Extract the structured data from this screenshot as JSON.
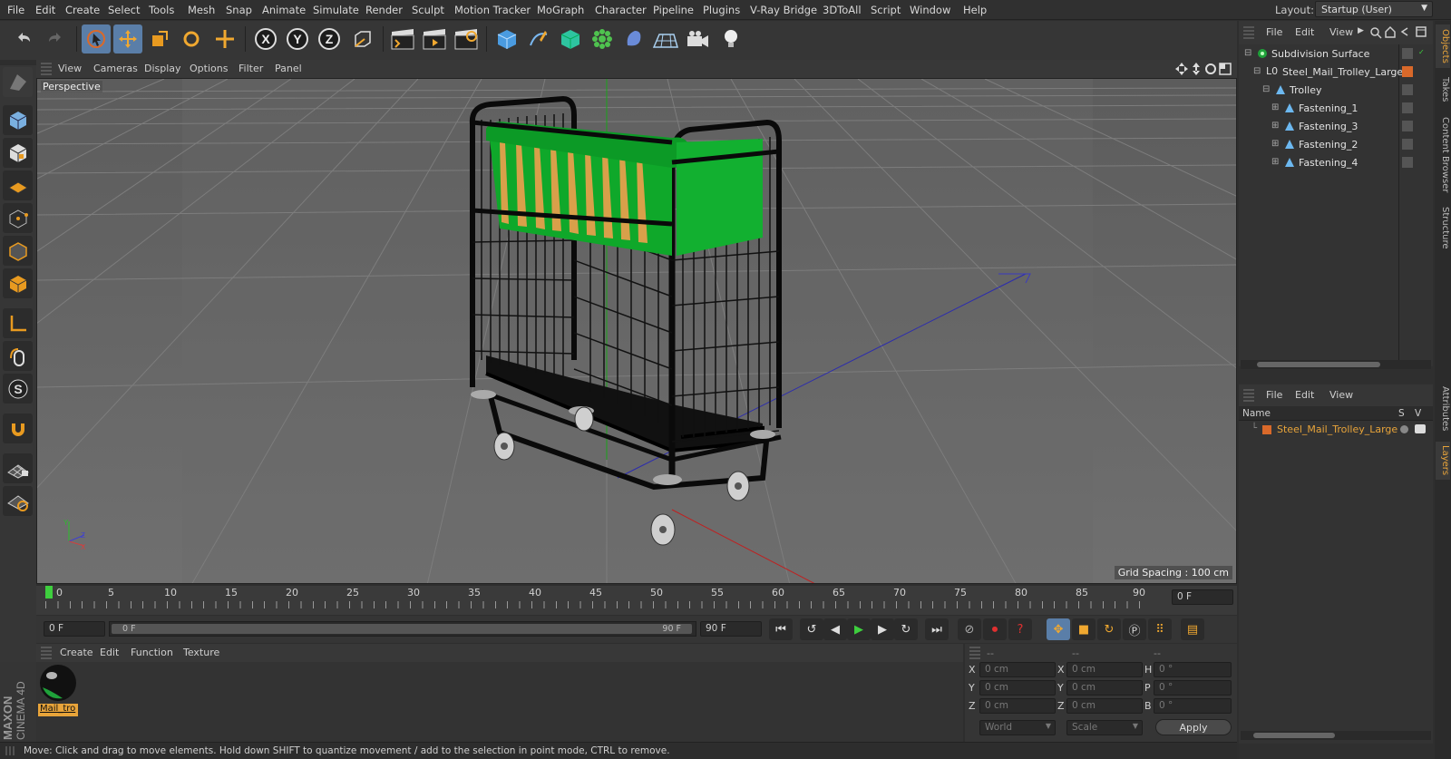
{
  "menubar": {
    "items": [
      "File",
      "Edit",
      "Create",
      "Select",
      "Tools",
      "Mesh",
      "Snap",
      "Animate",
      "Simulate",
      "Render",
      "Sculpt",
      "Motion Tracker",
      "MoGraph",
      "Character",
      "Pipeline",
      "Plugins",
      "V-Ray Bridge",
      "3DToAll",
      "Script",
      "Window",
      "Help"
    ],
    "layout_label": "Layout:",
    "layout_value": "Startup (User)"
  },
  "viewport": {
    "menus": [
      "View",
      "Cameras",
      "Display",
      "Options",
      "Filter",
      "Panel"
    ],
    "camera_label": "Perspective",
    "grid_spacing": "Grid Spacing : 100 cm"
  },
  "timeline": {
    "ticks": [
      "0",
      "5",
      "10",
      "15",
      "20",
      "25",
      "30",
      "35",
      "40",
      "45",
      "50",
      "55",
      "60",
      "65",
      "70",
      "75",
      "80",
      "85",
      "90"
    ],
    "current_frame": "0 F",
    "start_frame": "0 F",
    "range_start": "0 F",
    "range_end": "90 F",
    "end_frame": "90 F"
  },
  "material_manager": {
    "menus": [
      "Create",
      "Edit",
      "Function",
      "Texture"
    ],
    "material_name": "Mail_tro"
  },
  "coordinates": {
    "headers": [
      "--",
      "--",
      "--"
    ],
    "rows": [
      {
        "axis": "X",
        "pos": "0 cm",
        "axis2": "X",
        "size": "0 cm",
        "rot_axis": "H",
        "rot": "0 °"
      },
      {
        "axis": "Y",
        "pos": "0 cm",
        "axis2": "Y",
        "size": "0 cm",
        "rot_axis": "P",
        "rot": "0 °"
      },
      {
        "axis": "Z",
        "pos": "0 cm",
        "axis2": "Z",
        "size": "0 cm",
        "rot_axis": "B",
        "rot": "0 °"
      }
    ],
    "world_select": "World",
    "scale_select": "Scale",
    "apply_label": "Apply"
  },
  "status": {
    "text": "Move: Click and drag to move elements. Hold down SHIFT to quantize movement / add to the selection in point mode, CTRL to remove."
  },
  "brand": {
    "line1": "MAXON",
    "line2": "CINEMA 4D"
  },
  "object_manager": {
    "menus": [
      "File",
      "Edit",
      "View"
    ],
    "objects": [
      {
        "name": "Subdivision Surface",
        "indent": 0
      },
      {
        "name": "Steel_Mail_Trolley_Large",
        "indent": 1
      },
      {
        "name": "Trolley",
        "indent": 2
      },
      {
        "name": "Fastening_1",
        "indent": 3
      },
      {
        "name": "Fastening_3",
        "indent": 3
      },
      {
        "name": "Fastening_2",
        "indent": 3
      },
      {
        "name": "Fastening_4",
        "indent": 3
      }
    ]
  },
  "layer_manager": {
    "menus": [
      "File",
      "Edit",
      "View"
    ],
    "col_name": "Name",
    "col_s": "S",
    "col_v": "V",
    "layer_name": "Steel_Mail_Trolley_Large"
  },
  "side_tabs": [
    "Objects",
    "Takes",
    "Content Browser",
    "Structure",
    "Attributes",
    "Layers"
  ],
  "colors": {
    "accent": "#e8a43a",
    "selection": "#5a7ea8",
    "layer_orange": "#d9692a",
    "folder_green": "#1fa23a"
  }
}
